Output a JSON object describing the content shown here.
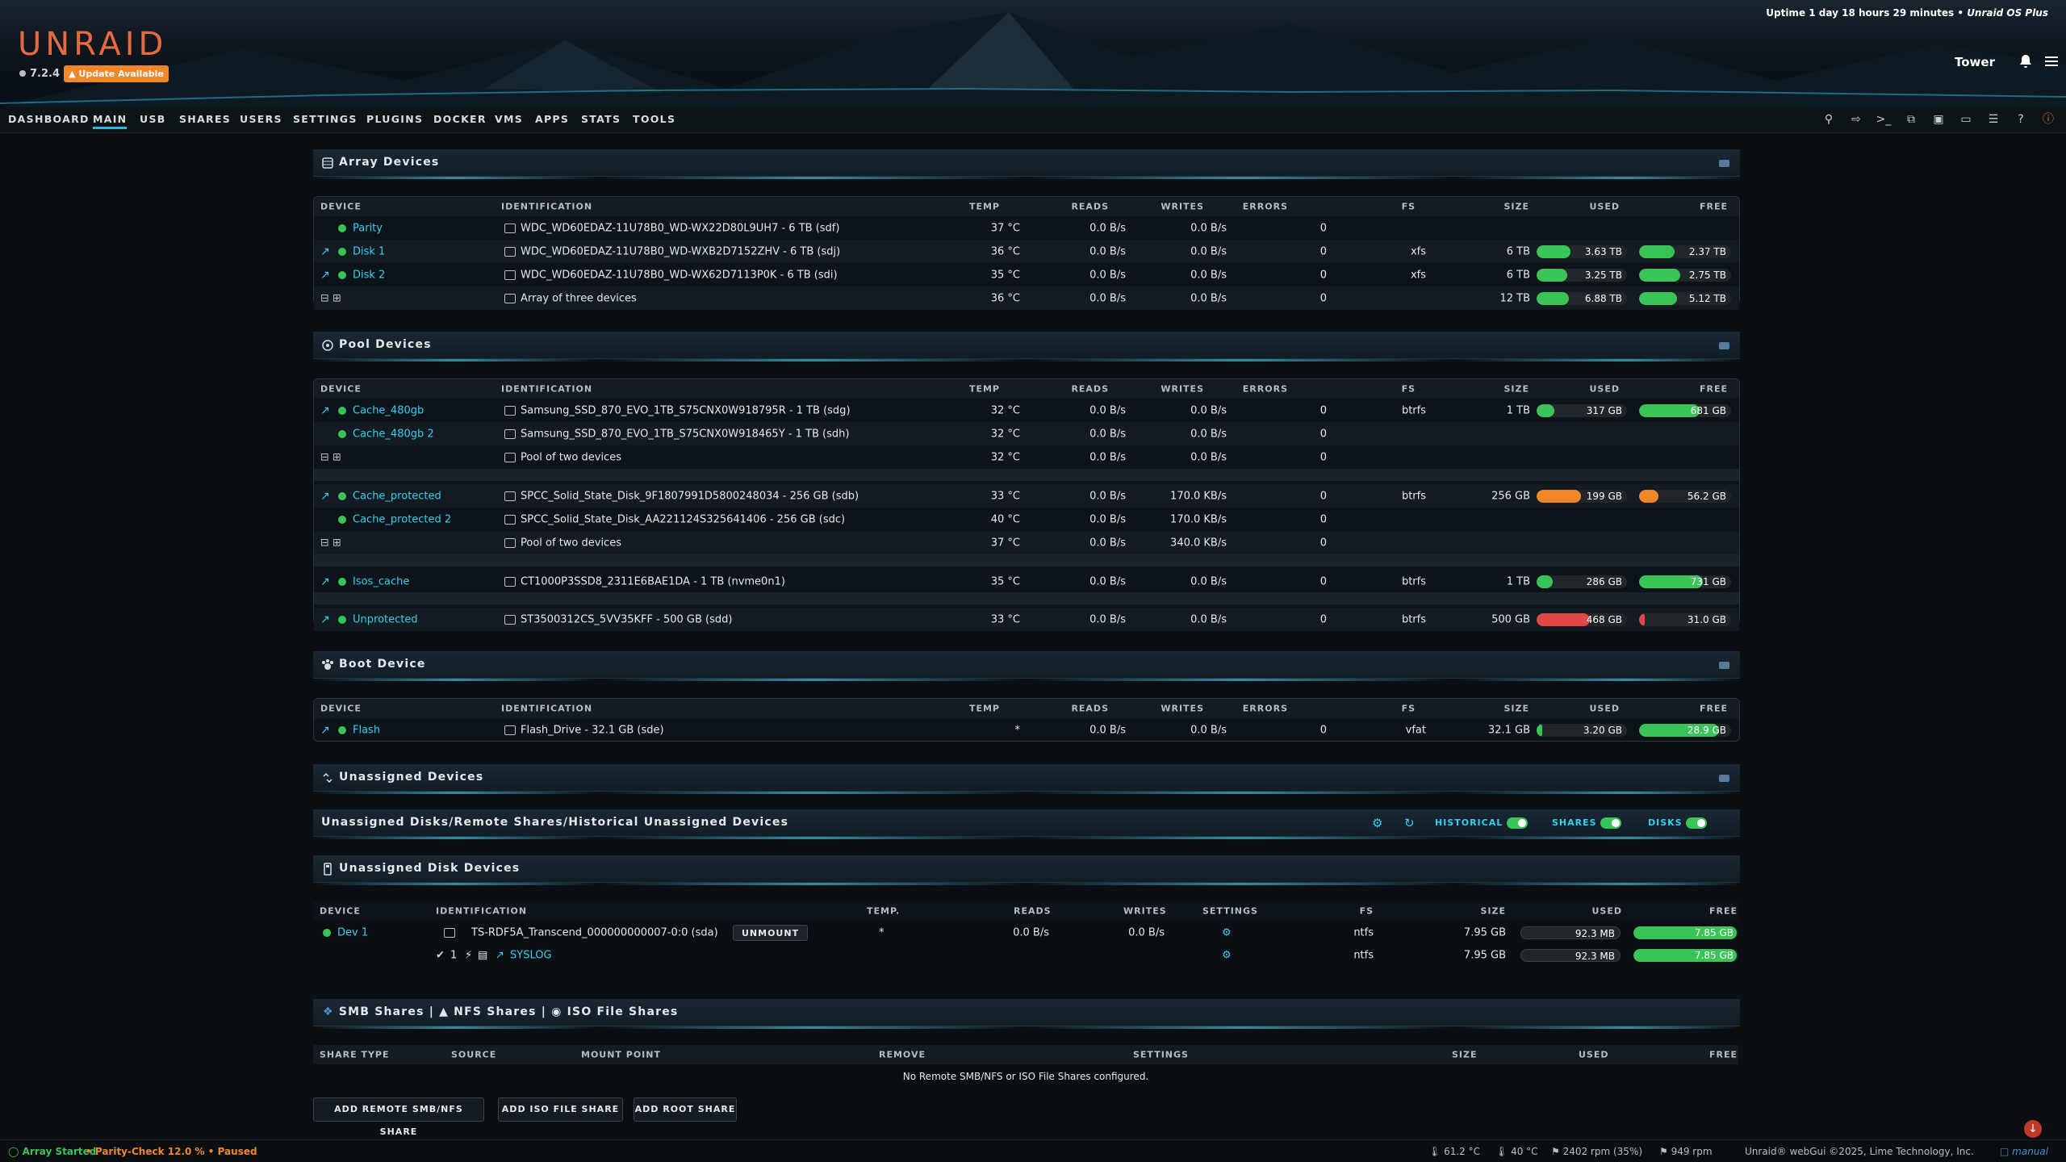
{
  "header": {
    "logo": "UNRAID",
    "version": "7.2.4",
    "update_label": "Update Available",
    "uptime": "Uptime 1 day 18 hours 29 minutes",
    "os_plus": "Unraid OS Plus",
    "server_name": "Tower"
  },
  "nav": {
    "items": [
      "DASHBOARD",
      "MAIN",
      "USB",
      "SHARES",
      "USERS",
      "SETTINGS",
      "PLUGINS",
      "DOCKER",
      "VMS",
      "APPS",
      "STATS",
      "TOOLS"
    ],
    "active": "MAIN"
  },
  "columns": [
    "DEVICE",
    "IDENTIFICATION",
    "TEMP",
    "READS",
    "WRITES",
    "ERRORS",
    "FS",
    "SIZE",
    "USED",
    "FREE"
  ],
  "array": {
    "title": "Array Devices",
    "rows": [
      {
        "device": "Parity",
        "id": "WDC_WD60EDAZ-11U78B0_WD-WX22D80L9UH7 - 6 TB (sdf)",
        "temp": "37 °C",
        "reads": "0.0 B/s",
        "writes": "0.0 B/s",
        "errors": "0",
        "fs": "",
        "size": "",
        "used": "",
        "free": ""
      },
      {
        "device": "Disk 1",
        "id": "WDC_WD60EDAZ-11U78B0_WD-WXB2D7152ZHV - 6 TB (sdj)",
        "temp": "36 °C",
        "reads": "0.0 B/s",
        "writes": "0.0 B/s",
        "errors": "0",
        "fs": "xfs",
        "size": "6 TB",
        "used": "3.63 TB",
        "free": "2.37 TB",
        "used_pct": 0.6,
        "free_pct": 0.4
      },
      {
        "device": "Disk 2",
        "id": "WDC_WD60EDAZ-11U78B0_WD-WX62D7113P0K - 6 TB (sdi)",
        "temp": "35 °C",
        "reads": "0.0 B/s",
        "writes": "0.0 B/s",
        "errors": "0",
        "fs": "xfs",
        "size": "6 TB",
        "used": "3.25 TB",
        "free": "2.75 TB",
        "used_pct": 0.54,
        "free_pct": 0.46
      },
      {
        "device": "",
        "id": "Array of three devices",
        "temp": "36 °C",
        "reads": "0.0 B/s",
        "writes": "0.0 B/s",
        "errors": "0",
        "fs": "",
        "size": "12 TB",
        "used": "6.88 TB",
        "free": "5.12 TB",
        "used_pct": 0.57,
        "free_pct": 0.43
      }
    ]
  },
  "pool": {
    "title": "Pool Devices",
    "rows": [
      {
        "device": "Cache_480gb",
        "id": "Samsung_SSD_870_EVO_1TB_S75CNX0W918795R - 1 TB (sdg)",
        "temp": "32 °C",
        "reads": "0.0 B/s",
        "writes": "0.0 B/s",
        "errors": "0",
        "fs": "btrfs",
        "size": "1 TB",
        "used": "317 GB",
        "free": "681 GB",
        "used_pct": 0.32,
        "free_pct": 0.68,
        "color": "green"
      },
      {
        "device": "Cache_480gb 2",
        "id": "Samsung_SSD_870_EVO_1TB_S75CNX0W918465Y - 1 TB (sdh)",
        "temp": "32 °C",
        "reads": "0.0 B/s",
        "writes": "0.0 B/s",
        "errors": "0"
      },
      {
        "device": "",
        "id": "Pool of two devices",
        "temp": "32 °C",
        "reads": "0.0 B/s",
        "writes": "0.0 B/s",
        "errors": "0"
      },
      {
        "device": "Cache_protected",
        "id": "SPCC_Solid_State_Disk_9F1807991D5800248034 - 256 GB (sdb)",
        "temp": "33 °C",
        "reads": "0.0 B/s",
        "writes": "170.0 KB/s",
        "errors": "0",
        "fs": "btrfs",
        "size": "256 GB",
        "used": "199 GB",
        "free": "56.2 GB",
        "used_pct": 0.78,
        "free_pct": 0.22,
        "color": "orange"
      },
      {
        "device": "Cache_protected 2",
        "id": "SPCC_Solid_State_Disk_AA221124S325641406 - 256 GB (sdc)",
        "temp": "40 °C",
        "reads": "0.0 B/s",
        "writes": "170.0 KB/s",
        "errors": "0"
      },
      {
        "device": "",
        "id": "Pool of two devices",
        "temp": "37 °C",
        "reads": "0.0 B/s",
        "writes": "340.0 KB/s",
        "errors": "0"
      },
      {
        "device": "Isos_cache",
        "id": "CT1000P3SSD8_2311E6BAE1DA - 1 TB (nvme0n1)",
        "temp": "35 °C",
        "reads": "0.0 B/s",
        "writes": "0.0 B/s",
        "errors": "0",
        "fs": "btrfs",
        "size": "1 TB",
        "used": "286 GB",
        "free": "731 GB",
        "used_pct": 0.28,
        "free_pct": 0.72,
        "color": "green"
      },
      {
        "device": "Unprotected",
        "id": "ST3500312CS_5VV35KFF - 500 GB (sdd)",
        "temp": "33 °C",
        "reads": "0.0 B/s",
        "writes": "0.0 B/s",
        "errors": "0",
        "fs": "btrfs",
        "size": "500 GB",
        "used": "468 GB",
        "free": "31.0 GB",
        "used_pct": 0.94,
        "free_pct": 0.06,
        "color": "red"
      }
    ]
  },
  "boot": {
    "title": "Boot Device",
    "rows": [
      {
        "device": "Flash",
        "id": "Flash_Drive - 32.1 GB (sde)",
        "temp": "*",
        "reads": "0.0 B/s",
        "writes": "0.0 B/s",
        "errors": "0",
        "fs": "vfat",
        "size": "32.1 GB",
        "used": "3.20 GB",
        "free": "28.9 GB",
        "used_pct": 0.1,
        "free_pct": 0.9
      }
    ]
  },
  "unassigned": {
    "title": "Unassigned Devices",
    "subtitle": "Unassigned Disks/Remote Shares/Historical Unassigned Devices",
    "toggles": [
      "HISTORICAL",
      "SHARES",
      "DISKS"
    ],
    "disk_title": "Unassigned Disk Devices",
    "columns": [
      "DEVICE",
      "IDENTIFICATION",
      "TEMP.",
      "READS",
      "WRITES",
      "SETTINGS",
      "FS",
      "SIZE",
      "USED",
      "FREE"
    ],
    "dev": {
      "device": "Dev 1",
      "id": "TS-RDF5A_Transcend_000000000007-0:0 (sda)",
      "unmount": "UNMOUNT",
      "temp": "*",
      "reads": "0.0 B/s",
      "writes": "0.0 B/s",
      "fs": "ntfs",
      "size": "7.95 GB",
      "used": "92.3 MB",
      "free": "7.85 GB"
    },
    "part": {
      "num": "1",
      "syslog": "SYSLOG",
      "fs": "ntfs",
      "size": "7.95 GB",
      "used": "92.3 MB",
      "free": "7.85 GB"
    }
  },
  "shares": {
    "title_parts": [
      "SMB Shares",
      "NFS Shares",
      "ISO File Shares"
    ],
    "separator": "|",
    "columns": [
      "SHARE TYPE",
      "SOURCE",
      "MOUNT POINT",
      "REMOVE",
      "SETTINGS",
      "SIZE",
      "USED",
      "FREE"
    ],
    "empty": "No Remote SMB/NFS or ISO File Shares configured.",
    "buttons": [
      "ADD REMOTE SMB/NFS SHARE",
      "ADD ISO FILE SHARE",
      "ADD ROOT SHARE"
    ]
  },
  "footer": {
    "array_status": "Array Started",
    "parity": "• Parity-Check 12.0 % • Paused",
    "temps": [
      "61.2 °C",
      "40 °C"
    ],
    "fans": [
      "2402 rpm (35%)",
      "949 rpm"
    ],
    "copyright": "Unraid® webGui ©2025, Lime Technology, Inc.",
    "manual": "manual"
  },
  "colors": {
    "green": "#3ac457",
    "orange": "#f0882a",
    "red": "#e04848",
    "accent": "#2fd0f0",
    "logo": "#e86a40"
  }
}
